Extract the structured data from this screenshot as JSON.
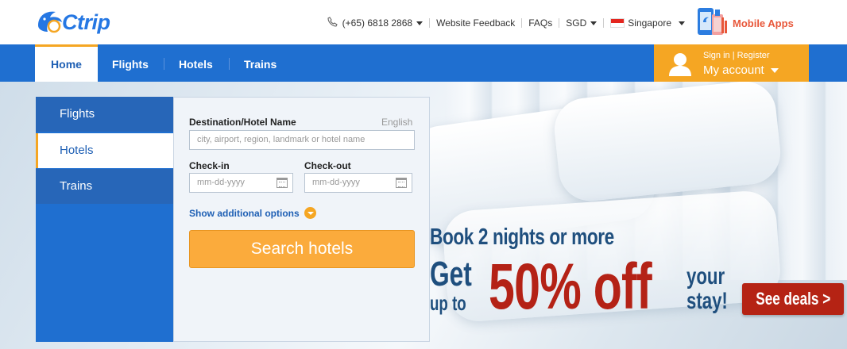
{
  "brand": {
    "name": "Ctrip"
  },
  "topbar": {
    "phone": "(+65) 6818 2868",
    "feedback": "Website Feedback",
    "faqs": "FAQs",
    "currency": "SGD",
    "region": "Singapore",
    "mobile_apps": "Mobile Apps"
  },
  "nav": {
    "items": [
      {
        "label": "Home",
        "active": true
      },
      {
        "label": "Flights"
      },
      {
        "label": "Hotels"
      },
      {
        "label": "Trains"
      }
    ]
  },
  "account": {
    "signin": "Sign in | Register",
    "label": "My account"
  },
  "search": {
    "tabs": [
      {
        "label": "Flights"
      },
      {
        "label": "Hotels",
        "active": true
      },
      {
        "label": "Trains"
      }
    ],
    "destination_label": "Destination/Hotel Name",
    "language": "English",
    "destination_placeholder": "city, airport, region, landmark or hotel name",
    "checkin_label": "Check-in",
    "checkout_label": "Check-out",
    "date_placeholder": "mm-dd-yyyy",
    "more_options": "Show additional options",
    "submit": "Search hotels"
  },
  "promo": {
    "line1": "Book 2 nights or more",
    "get": "Get",
    "up_to": "up to",
    "big": "50% off",
    "your": "your",
    "stay": "stay!",
    "cta": "See deals >"
  },
  "colors": {
    "brand_blue": "#1f6fd0",
    "accent_orange": "#f5a623",
    "promo_red": "#b42216"
  }
}
